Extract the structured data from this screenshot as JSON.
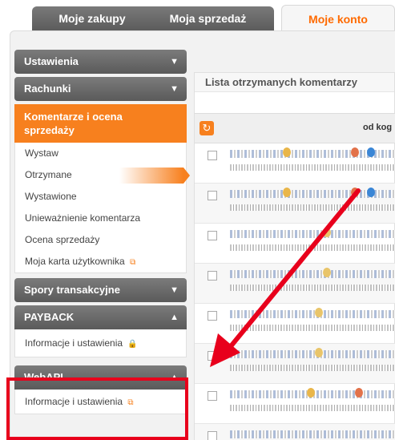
{
  "tabs": [
    {
      "label": "Moje zakupy"
    },
    {
      "label": "Moja sprzedaż"
    },
    {
      "label": "Moje konto"
    }
  ],
  "sidebar": {
    "ustawienia": "Ustawienia",
    "rachunki": "Rachunki",
    "komentarze": "Komentarze i ocena sprzedaży",
    "komentarze_items": [
      "Wystaw",
      "Otrzymane",
      "Wystawione",
      "Unieważnienie komentarza",
      "Ocena sprzedaży",
      "Moja karta użytkownika"
    ],
    "spory": "Spory transakcyjne",
    "payback": "PAYBACK",
    "payback_item": "Informacje i ustawienia",
    "webapi": "WebAPI",
    "webapi_item": "Informacje i ustawienia"
  },
  "main": {
    "title": "Lista otrzymanych komentarzy",
    "col_from": "od kog"
  },
  "colors": {
    "accent": "#f7801e",
    "highlight": "#e8001c",
    "tab_active_text": "#ff6a00"
  }
}
